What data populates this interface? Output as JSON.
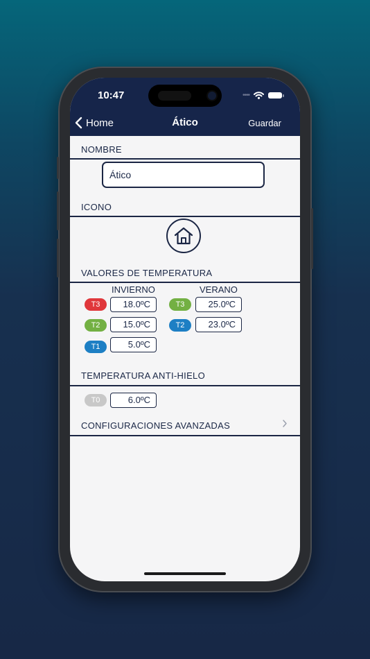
{
  "status_bar": {
    "time": "10:47",
    "signal": "••••"
  },
  "nav": {
    "back_label": "Home",
    "title": "Ático",
    "save_label": "Guardar"
  },
  "sections": {
    "nombre": "NOMBRE",
    "icono": "ICONO",
    "valores": "VALORES DE TEMPERATURA",
    "antihielo": "TEMPERATURA ANTI-HIELO"
  },
  "name_field": {
    "value": "Ático"
  },
  "icon": {
    "name": "home-icon"
  },
  "temperatures": {
    "invierno_label": "INVIERNO",
    "verano_label": "VERANO",
    "invierno": [
      {
        "tag": "T3",
        "value": "18.0ºC",
        "color": "#e0373b"
      },
      {
        "tag": "T2",
        "value": "15.0ºC",
        "color": "#73b043"
      },
      {
        "tag": "T1",
        "value": "5.0ºC",
        "color": "#1d7fc4"
      }
    ],
    "verano": [
      {
        "tag": "T3",
        "value": "25.0ºC",
        "color": "#73b043"
      },
      {
        "tag": "T2",
        "value": "23.0ºC",
        "color": "#1d7fc4"
      }
    ]
  },
  "antihielo": {
    "tag": "T0",
    "value": "6.0ºC",
    "color": "#c8c8c8"
  },
  "advanced": {
    "label": "CONFIGURACIONES AVANZADAS"
  }
}
